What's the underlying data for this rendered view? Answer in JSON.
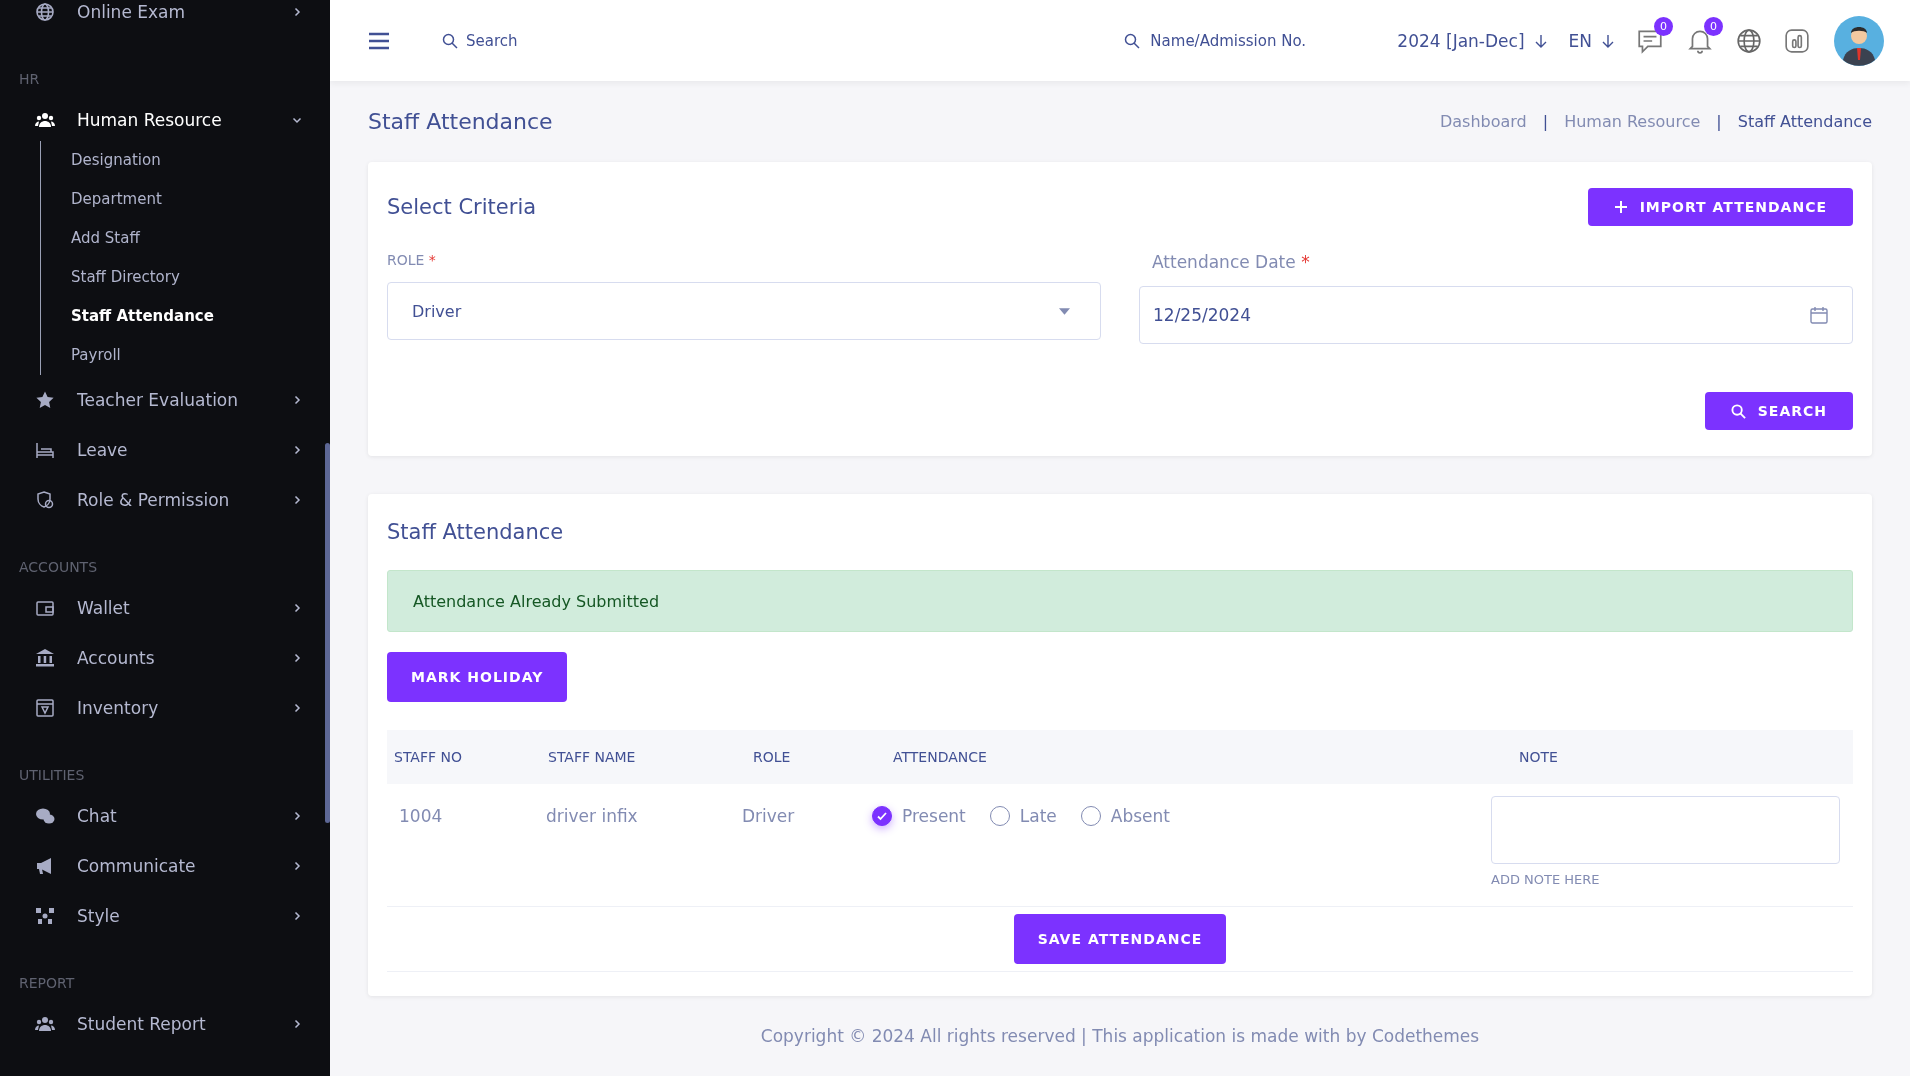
{
  "sidebar": {
    "sections": [
      {
        "items": [
          {
            "label": "Online Exam",
            "expanded": false,
            "selected": false
          }
        ]
      },
      {
        "heading": "HR",
        "items": [
          {
            "label": "Human Resource",
            "expanded": true,
            "selected": true,
            "children": [
              {
                "label": "Designation",
                "selected": false
              },
              {
                "label": "Department",
                "selected": false
              },
              {
                "label": "Add Staff",
                "selected": false
              },
              {
                "label": "Staff Directory",
                "selected": false
              },
              {
                "label": "Staff Attendance",
                "selected": true
              },
              {
                "label": "Payroll",
                "selected": false
              }
            ]
          },
          {
            "label": "Teacher Evaluation",
            "expanded": false,
            "selected": false
          },
          {
            "label": "Leave",
            "expanded": false,
            "selected": false
          },
          {
            "label": "Role & Permission",
            "expanded": false,
            "selected": false
          }
        ]
      },
      {
        "heading": "ACCOUNTS",
        "items": [
          {
            "label": "Wallet",
            "expanded": false,
            "selected": false
          },
          {
            "label": "Accounts",
            "expanded": false,
            "selected": false
          },
          {
            "label": "Inventory",
            "expanded": false,
            "selected": false
          }
        ]
      },
      {
        "heading": "UTILITIES",
        "items": [
          {
            "label": "Chat",
            "expanded": false,
            "selected": false
          },
          {
            "label": "Communicate",
            "expanded": false,
            "selected": false
          },
          {
            "label": "Style",
            "expanded": false,
            "selected": false
          }
        ]
      },
      {
        "heading": "REPORT",
        "items": [
          {
            "label": "Student Report",
            "expanded": false,
            "selected": false
          }
        ]
      }
    ]
  },
  "header": {
    "search_label": "Search",
    "student_search": {
      "placeholder": "Name/Admission No."
    },
    "session": "2024 [Jan-Dec]",
    "language": "EN",
    "message_count": "0",
    "notification_count": "0"
  },
  "page_title": "Staff Attendance",
  "breadcrumb": [
    {
      "label": "Dashboard",
      "selected": false
    },
    {
      "label": "Human Resource",
      "selected": false
    },
    {
      "label": "Staff Attendance",
      "selected": true
    }
  ],
  "breadcrumb_separator": "|",
  "criteria": {
    "title": "Select Criteria",
    "import_button": "IMPORT ATTENDANCE",
    "required_mark": "*",
    "fields": [
      {
        "kind": "select",
        "label": "ROLE",
        "required": true,
        "value": "Driver"
      },
      {
        "kind": "date",
        "label": "Attendance Date",
        "required": true,
        "value": "12/25/2024"
      }
    ],
    "search_button": "SEARCH"
  },
  "attendance": {
    "title": "Staff Attendance",
    "alert": "Attendance Already Submitted",
    "holiday_button": "MARK HOLIDAY",
    "columns": [
      "STAFF NO",
      "STAFF NAME",
      "ROLE",
      "ATTENDANCE",
      "NOTE"
    ],
    "rows": [
      {
        "staff_no": "1004",
        "staff_name": "driver infix",
        "role": "Driver",
        "options": [
          {
            "label": "Present",
            "selected": true
          },
          {
            "label": "Late",
            "selected": false
          },
          {
            "label": "Absent",
            "selected": false
          }
        ],
        "note_hint": "ADD NOTE HERE"
      }
    ],
    "save_button": "SAVE ATTENDANCE"
  },
  "footer": "Copyright © 2024 All rights reserved | This application is made with by Codethemes"
}
